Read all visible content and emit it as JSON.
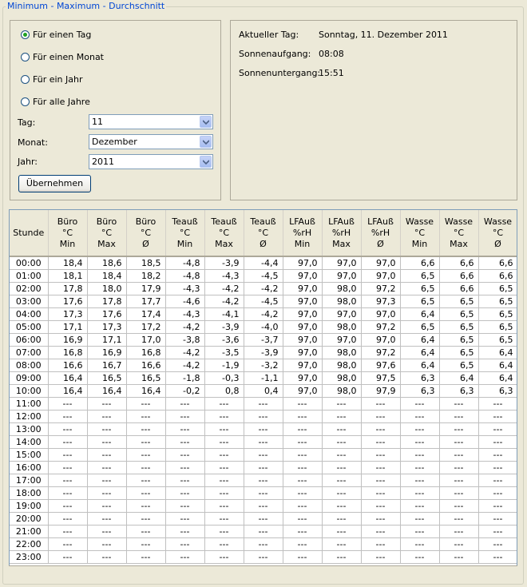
{
  "group_title": "Minimum - Maximum - Durchschnitt",
  "radios": [
    {
      "label": "Für einen Tag",
      "checked": true
    },
    {
      "label": "Für einen Monat",
      "checked": false
    },
    {
      "label": "Für ein Jahr",
      "checked": false
    },
    {
      "label": "Für alle Jahre",
      "checked": false
    }
  ],
  "fields": {
    "day_label": "Tag:",
    "day_value": "11",
    "month_label": "Monat:",
    "month_value": "Dezember",
    "year_label": "Jahr:",
    "year_value": "2011"
  },
  "apply_label": "Übernehmen",
  "info": {
    "current_day_label": "Aktueller Tag:",
    "current_day_value": "Sonntag, 11. Dezember 2011",
    "sunrise_label": "Sonnenaufgang:",
    "sunrise_value": "08:08",
    "sunset_label": "Sonnenuntergang:",
    "sunset_value": "15:51"
  },
  "table": {
    "headers": [
      [
        "Stunde"
      ],
      [
        "Büro",
        "°C",
        "Min"
      ],
      [
        "Büro",
        "°C",
        "Max"
      ],
      [
        "Büro",
        "°C",
        "Ø"
      ],
      [
        "Teauß",
        "°C",
        "Min"
      ],
      [
        "Teauß",
        "°C",
        "Max"
      ],
      [
        "Teauß",
        "°C",
        "Ø"
      ],
      [
        "LFAuß",
        "%rH",
        "Min"
      ],
      [
        "LFAuß",
        "%rH",
        "Max"
      ],
      [
        "LFAuß",
        "%rH",
        "Ø"
      ],
      [
        "Wasse",
        "°C",
        "Min"
      ],
      [
        "Wasse",
        "°C",
        "Max"
      ],
      [
        "Wasse",
        "°C",
        "Ø"
      ]
    ],
    "rows": [
      [
        "00:00",
        "18,4",
        "18,6",
        "18,5",
        "-4,8",
        "-3,9",
        "-4,4",
        "97,0",
        "97,0",
        "97,0",
        "6,6",
        "6,6",
        "6,6"
      ],
      [
        "01:00",
        "18,1",
        "18,4",
        "18,2",
        "-4,8",
        "-4,3",
        "-4,5",
        "97,0",
        "97,0",
        "97,0",
        "6,5",
        "6,6",
        "6,6"
      ],
      [
        "02:00",
        "17,8",
        "18,0",
        "17,9",
        "-4,3",
        "-4,2",
        "-4,2",
        "97,0",
        "98,0",
        "97,2",
        "6,5",
        "6,6",
        "6,5"
      ],
      [
        "03:00",
        "17,6",
        "17,8",
        "17,7",
        "-4,6",
        "-4,2",
        "-4,5",
        "97,0",
        "98,0",
        "97,3",
        "6,5",
        "6,5",
        "6,5"
      ],
      [
        "04:00",
        "17,3",
        "17,6",
        "17,4",
        "-4,3",
        "-4,1",
        "-4,2",
        "97,0",
        "97,0",
        "97,0",
        "6,4",
        "6,5",
        "6,5"
      ],
      [
        "05:00",
        "17,1",
        "17,3",
        "17,2",
        "-4,2",
        "-3,9",
        "-4,0",
        "97,0",
        "98,0",
        "97,2",
        "6,5",
        "6,5",
        "6,5"
      ],
      [
        "06:00",
        "16,9",
        "17,1",
        "17,0",
        "-3,8",
        "-3,6",
        "-3,7",
        "97,0",
        "97,0",
        "97,0",
        "6,4",
        "6,5",
        "6,5"
      ],
      [
        "07:00",
        "16,8",
        "16,9",
        "16,8",
        "-4,2",
        "-3,5",
        "-3,9",
        "97,0",
        "98,0",
        "97,2",
        "6,4",
        "6,5",
        "6,4"
      ],
      [
        "08:00",
        "16,6",
        "16,7",
        "16,6",
        "-4,2",
        "-1,9",
        "-3,2",
        "97,0",
        "98,0",
        "97,6",
        "6,4",
        "6,5",
        "6,4"
      ],
      [
        "09:00",
        "16,4",
        "16,5",
        "16,5",
        "-1,8",
        "-0,3",
        "-1,1",
        "97,0",
        "98,0",
        "97,5",
        "6,3",
        "6,4",
        "6,4"
      ],
      [
        "10:00",
        "16,4",
        "16,4",
        "16,4",
        "-0,2",
        "0,8",
        "0,4",
        "97,0",
        "98,0",
        "97,9",
        "6,3",
        "6,3",
        "6,3"
      ],
      [
        "11:00",
        "---",
        "---",
        "---",
        "---",
        "---",
        "---",
        "---",
        "---",
        "---",
        "---",
        "---",
        "---"
      ],
      [
        "12:00",
        "---",
        "---",
        "---",
        "---",
        "---",
        "---",
        "---",
        "---",
        "---",
        "---",
        "---",
        "---"
      ],
      [
        "13:00",
        "---",
        "---",
        "---",
        "---",
        "---",
        "---",
        "---",
        "---",
        "---",
        "---",
        "---",
        "---"
      ],
      [
        "14:00",
        "---",
        "---",
        "---",
        "---",
        "---",
        "---",
        "---",
        "---",
        "---",
        "---",
        "---",
        "---"
      ],
      [
        "15:00",
        "---",
        "---",
        "---",
        "---",
        "---",
        "---",
        "---",
        "---",
        "---",
        "---",
        "---",
        "---"
      ],
      [
        "16:00",
        "---",
        "---",
        "---",
        "---",
        "---",
        "---",
        "---",
        "---",
        "---",
        "---",
        "---",
        "---"
      ],
      [
        "17:00",
        "---",
        "---",
        "---",
        "---",
        "---",
        "---",
        "---",
        "---",
        "---",
        "---",
        "---",
        "---"
      ],
      [
        "18:00",
        "---",
        "---",
        "---",
        "---",
        "---",
        "---",
        "---",
        "---",
        "---",
        "---",
        "---",
        "---"
      ],
      [
        "19:00",
        "---",
        "---",
        "---",
        "---",
        "---",
        "---",
        "---",
        "---",
        "---",
        "---",
        "---",
        "---"
      ],
      [
        "20:00",
        "---",
        "---",
        "---",
        "---",
        "---",
        "---",
        "---",
        "---",
        "---",
        "---",
        "---",
        "---"
      ],
      [
        "21:00",
        "---",
        "---",
        "---",
        "---",
        "---",
        "---",
        "---",
        "---",
        "---",
        "---",
        "---",
        "---"
      ],
      [
        "22:00",
        "---",
        "---",
        "---",
        "---",
        "---",
        "---",
        "---",
        "---",
        "---",
        "---",
        "---",
        "---"
      ],
      [
        "23:00",
        "---",
        "---",
        "---",
        "---",
        "---",
        "---",
        "---",
        "---",
        "---",
        "---",
        "---",
        "---"
      ]
    ]
  }
}
